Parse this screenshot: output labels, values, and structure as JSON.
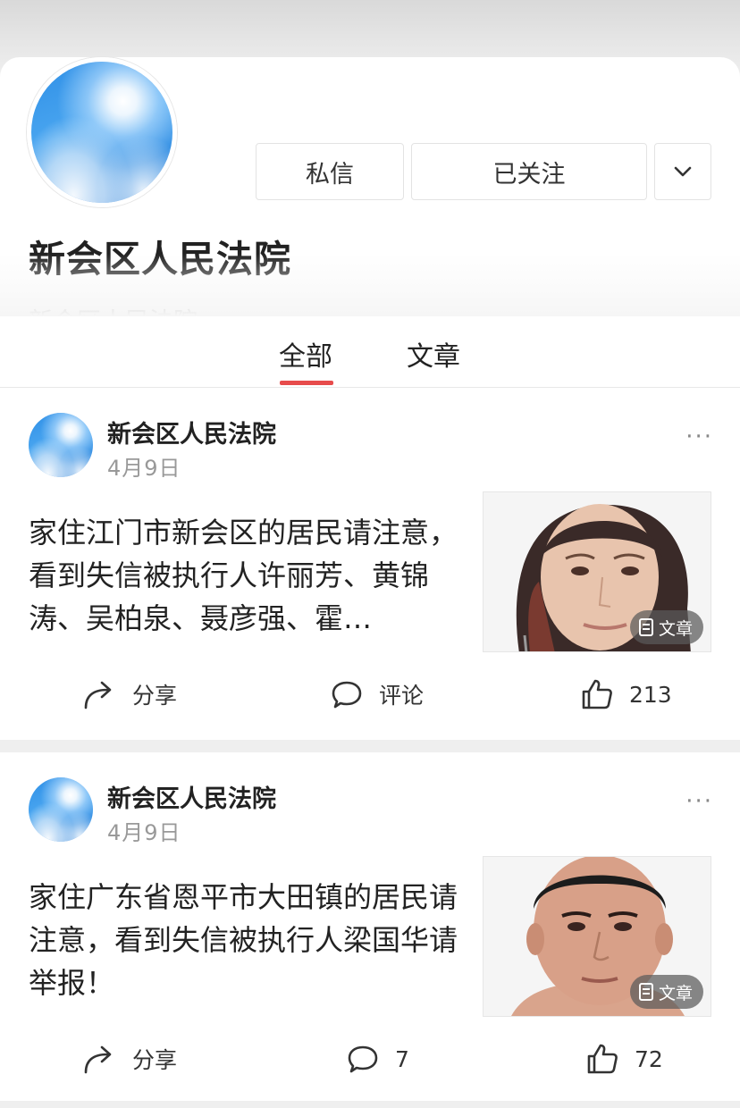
{
  "profile": {
    "name": "新会区人民法院",
    "description": "新会区人民法院",
    "dm_label": "私信",
    "follow_label": "已关注"
  },
  "tabs": [
    {
      "label": "全部",
      "active": true
    },
    {
      "label": "文章",
      "active": false
    }
  ],
  "posts": [
    {
      "author": "新会区人民法院",
      "date": "4月9日",
      "content": "家住江门市新会区的居民请注意，看到失信被执行人许丽芳、黄锦涛、吴柏泉、聂彦强、霍…",
      "badge": "文章",
      "share_label": "分享",
      "comment_label": "评论",
      "like_count": "213"
    },
    {
      "author": "新会区人民法院",
      "date": "4月9日",
      "content": "家住广东省恩平市大田镇的居民请注意，看到失信被执行人梁国华请举报！",
      "badge": "文章",
      "share_label": "分享",
      "comment_count": "7",
      "like_count": "72"
    }
  ],
  "colors": {
    "accent": "#e74c4c"
  }
}
